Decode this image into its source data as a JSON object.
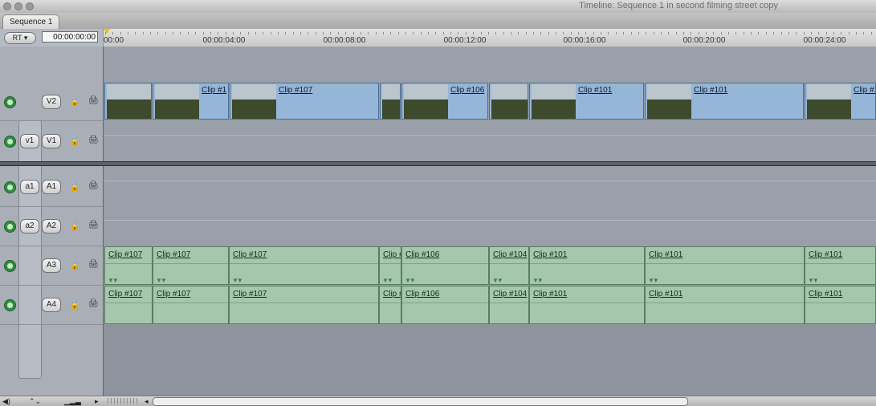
{
  "window": {
    "title": "Timeline: Sequence 1 in second filming street copy"
  },
  "tabs": [
    {
      "label": "Sequence 1"
    }
  ],
  "toolbar": {
    "rt_label": "RT",
    "timecode": "00:00:00:00"
  },
  "ruler": {
    "labels": [
      "00:00",
      "00:00:04:00",
      "00:00:08:00",
      "00:00:12:00",
      "00:00:16:00",
      "00:00:20:00",
      "00:00:24:00"
    ]
  },
  "tracks": {
    "V2": {
      "dest": "V2"
    },
    "V1": {
      "source": "v1",
      "dest": "V1"
    },
    "A1": {
      "source": "a1",
      "dest": "A1"
    },
    "A2": {
      "source": "a2",
      "dest": "A2"
    },
    "A3": {
      "dest": "A3"
    },
    "A4": {
      "dest": "A4"
    }
  },
  "video_clips": [
    "",
    "Clip #1",
    "Clip #107",
    "",
    "Clip #106",
    "",
    "Clip #101",
    "Clip #101",
    "Clip #1"
  ],
  "a3_clips": [
    "Clip #107",
    "Clip #107",
    "Clip #107",
    "Clip #",
    "Clip #106",
    "Clip #104",
    "Clip #101",
    "Clip #101",
    "Clip #101"
  ],
  "a4_clips": [
    "Clip #107",
    "Clip #107",
    "Clip #107",
    "Clip #",
    "Clip #106",
    "Clip #104",
    "Clip #101",
    "Clip #101",
    "Clip #101"
  ],
  "icons": {
    "visibility": "eye-icon",
    "audio": "speaker-icon",
    "lock": "lock-icon",
    "target": "auto-select-icon",
    "playhead": "playhead-icon"
  },
  "colors": {
    "video_clip": "#96b6d8",
    "audio_clip": "#a5c8ad",
    "track_bg": "#9aa0a9",
    "playhead": "#e5c300"
  }
}
